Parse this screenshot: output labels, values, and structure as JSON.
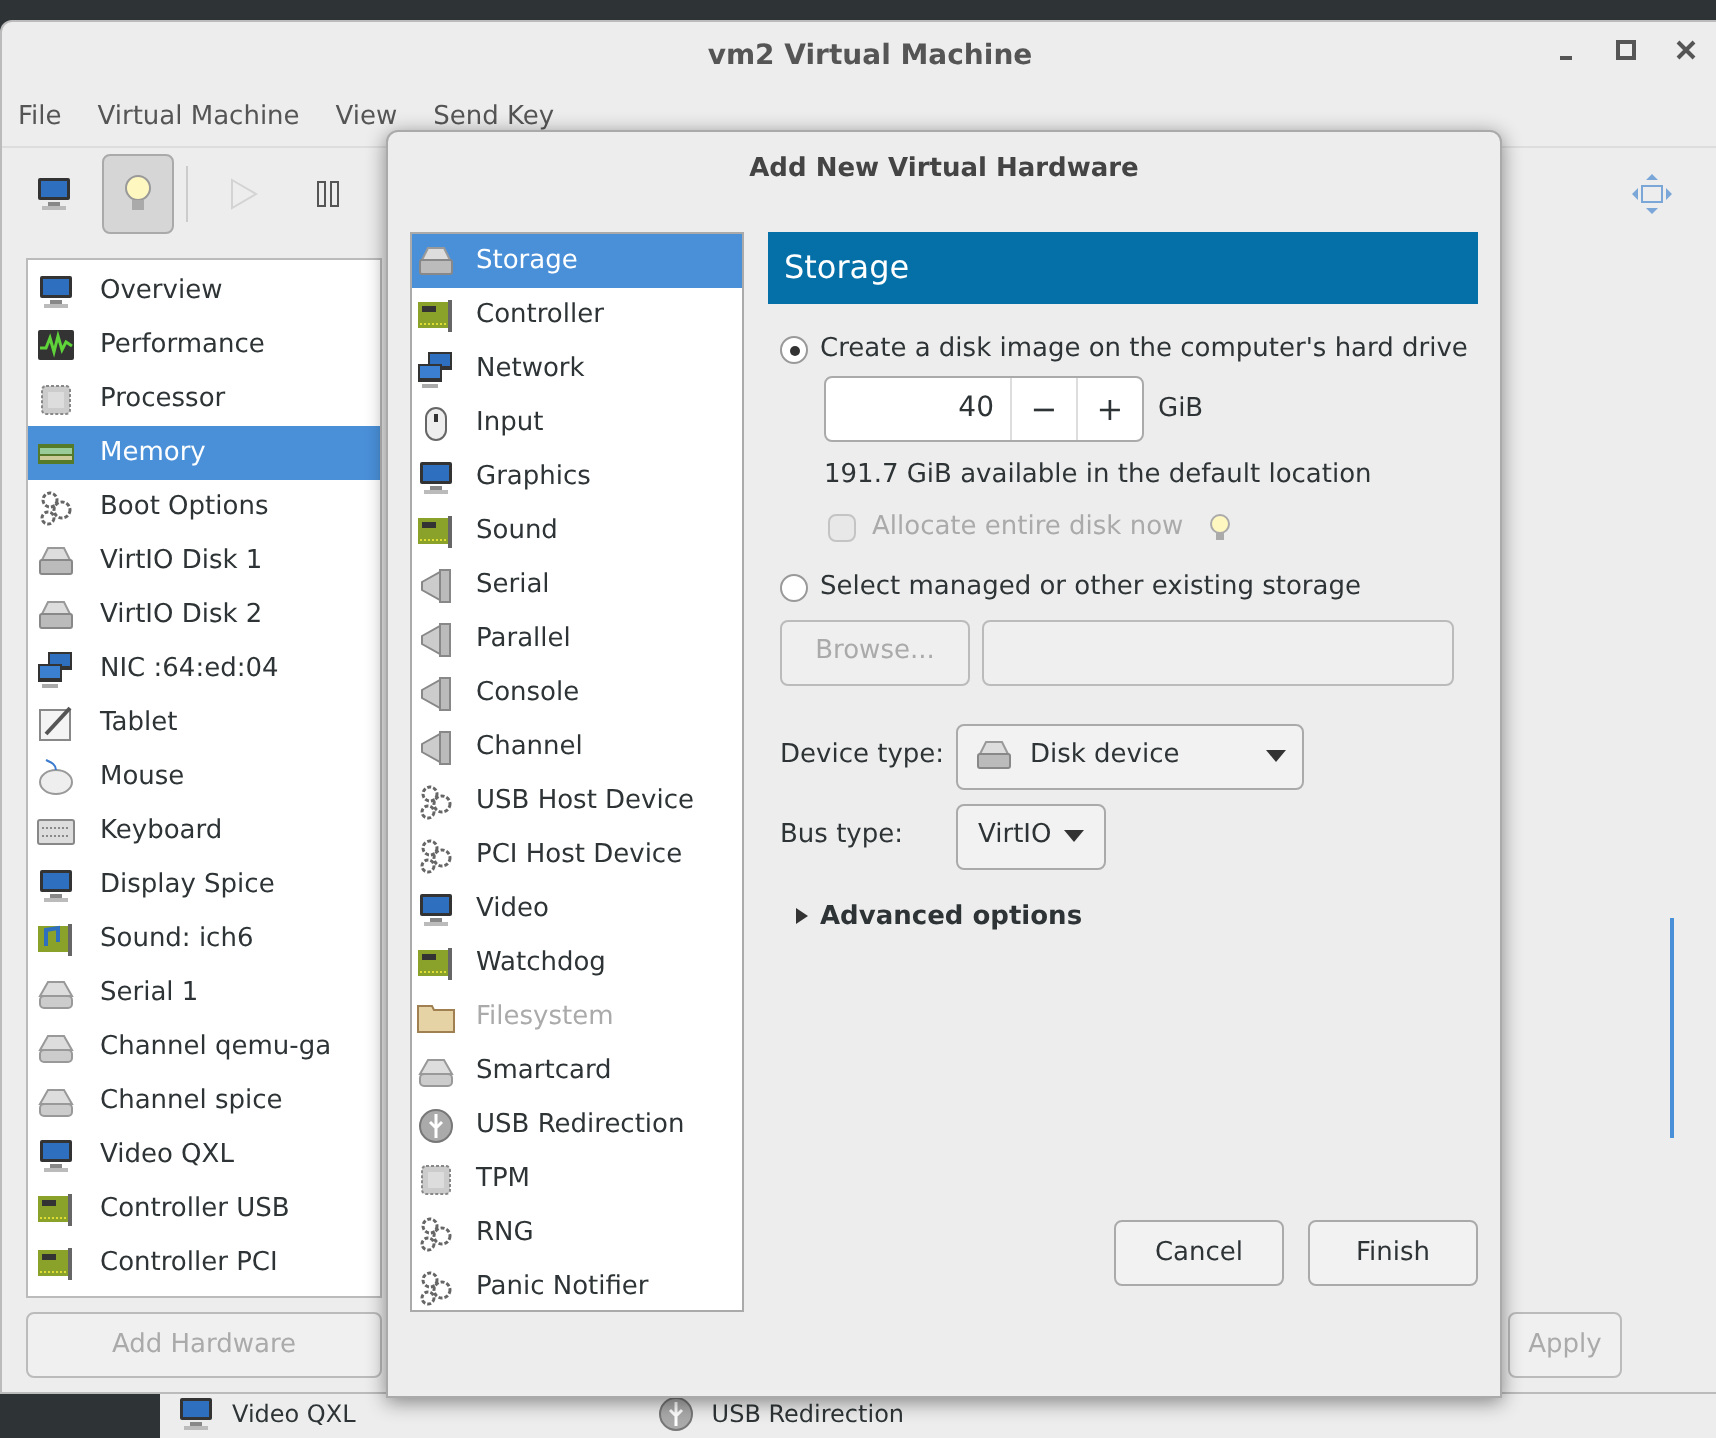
{
  "window": {
    "title": "vm2 Virtual Machine"
  },
  "menu": [
    "File",
    "Virtual Machine",
    "View",
    "Send Key"
  ],
  "toolbar": [
    {
      "kind": "monitor",
      "selected": false,
      "disabled": false
    },
    {
      "kind": "bulb",
      "selected": true,
      "disabled": false
    },
    {
      "kind": "play",
      "selected": false,
      "disabled": true
    },
    {
      "kind": "pause",
      "selected": false,
      "disabled": false
    }
  ],
  "sidebar": {
    "items": [
      {
        "label": "Overview",
        "kind": "monitor",
        "selected": false
      },
      {
        "label": "Performance",
        "kind": "chart",
        "selected": false
      },
      {
        "label": "Processor",
        "kind": "chip",
        "selected": false
      },
      {
        "label": "Memory",
        "kind": "ram",
        "selected": true
      },
      {
        "label": "Boot Options",
        "kind": "gears",
        "selected": false
      },
      {
        "label": "VirtIO Disk 1",
        "kind": "disk",
        "selected": false
      },
      {
        "label": "VirtIO Disk 2",
        "kind": "disk",
        "selected": false
      },
      {
        "label": "NIC :64:ed:04",
        "kind": "network",
        "selected": false
      },
      {
        "label": "Tablet",
        "kind": "tablet",
        "selected": false
      },
      {
        "label": "Mouse",
        "kind": "mouse",
        "selected": false
      },
      {
        "label": "Keyboard",
        "kind": "keyboard",
        "selected": false
      },
      {
        "label": "Display Spice",
        "kind": "monitor",
        "selected": false
      },
      {
        "label": "Sound: ich6",
        "kind": "sound",
        "selected": false
      },
      {
        "label": "Serial 1",
        "kind": "serial",
        "selected": false
      },
      {
        "label": "Channel qemu-ga",
        "kind": "serial",
        "selected": false
      },
      {
        "label": "Channel spice",
        "kind": "serial",
        "selected": false
      },
      {
        "label": "Video QXL",
        "kind": "monitor",
        "selected": false
      },
      {
        "label": "Controller USB",
        "kind": "card",
        "selected": false
      },
      {
        "label": "Controller PCI",
        "kind": "card",
        "selected": false
      }
    ],
    "add_button": {
      "label": "Add Hardware",
      "disabled": true
    }
  },
  "apply_button": {
    "label": "Apply",
    "disabled": true
  },
  "background_window": {
    "items": [
      {
        "label": "Video QXL",
        "kind": "monitor"
      },
      {
        "label": "USB Redirection",
        "kind": "usb"
      }
    ]
  },
  "dialog": {
    "title": "Add New Virtual Hardware",
    "items": [
      {
        "label": "Storage",
        "kind": "disk",
        "selected": true,
        "disabled": false
      },
      {
        "label": "Controller",
        "kind": "card",
        "selected": false,
        "disabled": false
      },
      {
        "label": "Network",
        "kind": "network",
        "selected": false,
        "disabled": false
      },
      {
        "label": "Input",
        "kind": "mouse-input",
        "selected": false,
        "disabled": false
      },
      {
        "label": "Graphics",
        "kind": "monitor",
        "selected": false,
        "disabled": false
      },
      {
        "label": "Sound",
        "kind": "card",
        "selected": false,
        "disabled": false
      },
      {
        "label": "Serial",
        "kind": "plug",
        "selected": false,
        "disabled": false
      },
      {
        "label": "Parallel",
        "kind": "plug",
        "selected": false,
        "disabled": false
      },
      {
        "label": "Console",
        "kind": "plug",
        "selected": false,
        "disabled": false
      },
      {
        "label": "Channel",
        "kind": "plug",
        "selected": false,
        "disabled": false
      },
      {
        "label": "USB Host Device",
        "kind": "gears",
        "selected": false,
        "disabled": false
      },
      {
        "label": "PCI Host Device",
        "kind": "gears",
        "selected": false,
        "disabled": false
      },
      {
        "label": "Video",
        "kind": "monitor",
        "selected": false,
        "disabled": false
      },
      {
        "label": "Watchdog",
        "kind": "card",
        "selected": false,
        "disabled": false
      },
      {
        "label": "Filesystem",
        "kind": "folder",
        "selected": false,
        "disabled": true
      },
      {
        "label": "Smartcard",
        "kind": "serial",
        "selected": false,
        "disabled": false
      },
      {
        "label": "USB Redirection",
        "kind": "usb",
        "selected": false,
        "disabled": false
      },
      {
        "label": "TPM",
        "kind": "chip",
        "selected": false,
        "disabled": false
      },
      {
        "label": "RNG",
        "kind": "gears",
        "selected": false,
        "disabled": false
      },
      {
        "label": "Panic Notifier",
        "kind": "gears",
        "selected": false,
        "disabled": false
      }
    ],
    "section_title": "Storage",
    "create_option": {
      "label": "Create a disk image on the computer's hard drive",
      "selected": true
    },
    "size": {
      "value": "40",
      "unit": "GiB",
      "minus": "−",
      "plus": "+"
    },
    "available": "191.7 GiB available in the default location",
    "allocate": {
      "label": "Allocate entire disk now",
      "checked": false,
      "disabled": true
    },
    "existing_option": {
      "label": "Select managed or other existing storage",
      "selected": false
    },
    "browse_button": {
      "label": "Browse...",
      "disabled": true
    },
    "device_type": {
      "label": "Device type:",
      "value": "Disk device"
    },
    "bus_type": {
      "label": "Bus type:",
      "value": "VirtIO"
    },
    "advanced": {
      "label": "Advanced options",
      "expanded": false
    },
    "buttons": [
      "Cancel",
      "Finish"
    ]
  }
}
